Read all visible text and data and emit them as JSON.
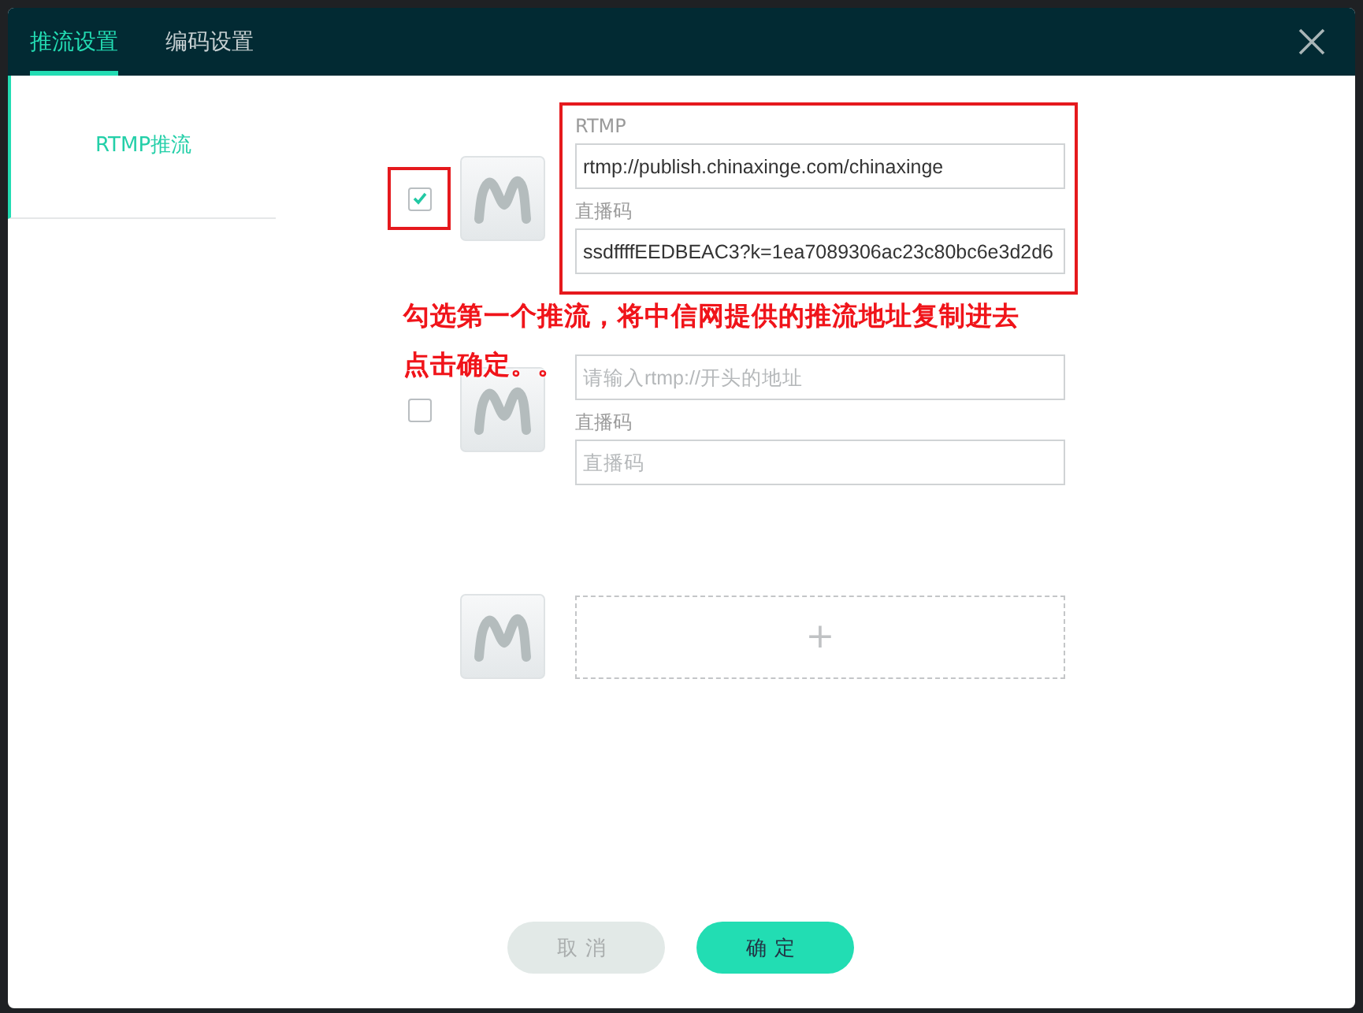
{
  "tabs": [
    {
      "label": "推流设置",
      "selected": true
    },
    {
      "label": "编码设置",
      "selected": false
    }
  ],
  "sidebar": {
    "items": [
      {
        "label": "RTMP推流",
        "selected": true
      }
    ]
  },
  "streams": [
    {
      "kind": "entry",
      "checked": true,
      "highlighted": true,
      "url_label": "RTMP",
      "url_value": "rtmp://publish.chinaxinge.com/chinaxinge",
      "key_label": "直播码",
      "key_value": "ssdffffEEDBEAC3?k=1ea7089306ac23c80bc6e3d2d6"
    },
    {
      "kind": "entry",
      "checked": false,
      "highlighted": false,
      "url_placeholder": "请输入rtmp://开头的地址",
      "key_label": "直播码",
      "key_placeholder": "直播码"
    },
    {
      "kind": "add",
      "add_symbol": "+"
    }
  ],
  "annotation": {
    "lines": [
      "勾选第一个推流，将中信网提供的推流地址复制进去",
      "点击确定。。"
    ]
  },
  "buttons": [
    {
      "label": "取消",
      "kind": "secondary"
    },
    {
      "label": "确定",
      "kind": "primary"
    }
  ]
}
